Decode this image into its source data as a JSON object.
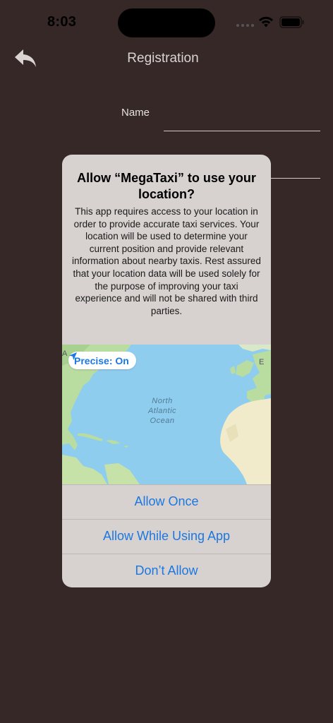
{
  "status_bar": {
    "time": "8:03"
  },
  "nav": {
    "title": "Registration",
    "back_icon": "back-arrow-icon"
  },
  "form": {
    "name_label": "Name"
  },
  "alert": {
    "title": "Allow “MegaTaxi” to use your location?",
    "message": "This app requires access to your location in order to provide accurate taxi services. Your location will be used to determine your current position and provide relevant information about nearby taxis. Rest assured that your location data will be used solely for the purpose of improving your taxi experience and will not be shared with third parties.",
    "map": {
      "precise_label": "Precise: On",
      "ocean_line1": "North",
      "ocean_line2": "Atlantic",
      "ocean_line3": "Ocean",
      "edge_letter_left": "A",
      "edge_letter_right": "E"
    },
    "buttons": {
      "allow_once": "Allow Once",
      "allow_while_using": "Allow While Using App",
      "dont_allow": "Don’t Allow"
    }
  },
  "colors": {
    "background": "#352827",
    "alert_background": "#d7d1d0",
    "accent_blue": "#1b78e0",
    "ocean": "#8fcdef"
  }
}
